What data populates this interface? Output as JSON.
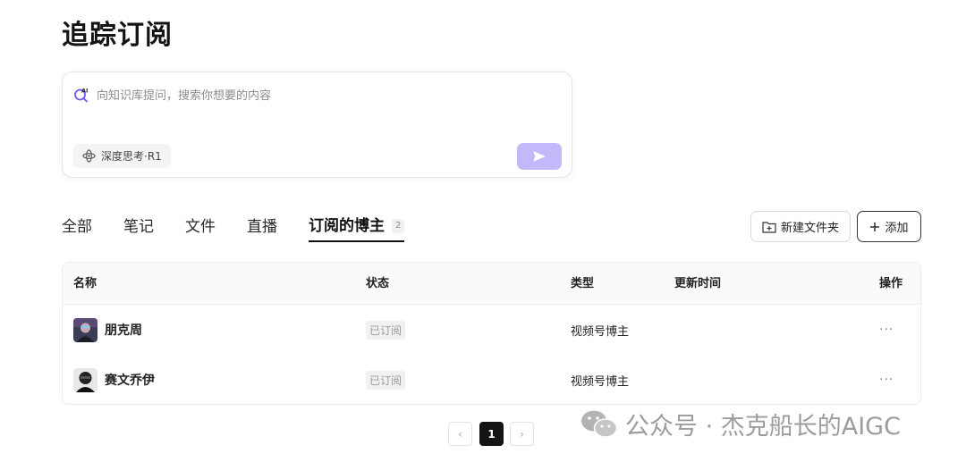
{
  "page": {
    "title": "追踪订阅"
  },
  "search": {
    "placeholder": "向知识库提问，搜索你想要的内容",
    "deep_think_label": "深度思考·R1",
    "send_color": "#c5b8fa"
  },
  "tabs": [
    {
      "label": "全部"
    },
    {
      "label": "笔记"
    },
    {
      "label": "文件"
    },
    {
      "label": "直播"
    },
    {
      "label": "订阅的博主",
      "count": "2",
      "active": true
    }
  ],
  "toolbar": {
    "new_folder_label": "新建文件夹",
    "add_label": "添加"
  },
  "table": {
    "columns": [
      "名称",
      "状态",
      "类型",
      "更新时间",
      "操作"
    ],
    "rows": [
      {
        "name": "朋克周",
        "status": "已订阅",
        "type": "视频号博主",
        "updated": "",
        "actions": "···"
      },
      {
        "name": "赛文乔伊",
        "status": "已订阅",
        "type": "视频号博主",
        "updated": "",
        "actions": "···"
      }
    ]
  },
  "pagination": {
    "prev": "‹",
    "current": "1",
    "next": "›"
  },
  "watermark": {
    "text": "公众号 · 杰克船长的AIGC"
  },
  "colors": {
    "accent": "#7b61ff",
    "text": "#1f1f1f",
    "muted": "#9a9a9a"
  }
}
